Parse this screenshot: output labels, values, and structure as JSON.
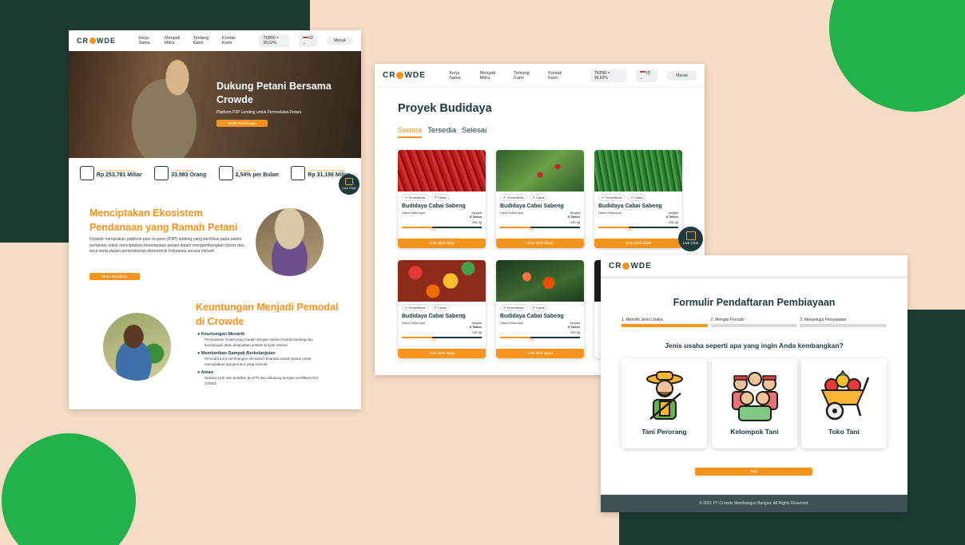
{
  "colors": {
    "accent": "#f7941d",
    "dark": "#1d3b3a",
    "green": "#22b24c",
    "peach": "#f6dcc4"
  },
  "nav": {
    "logo": "CR●WDE",
    "links": [
      "Kerja Sama",
      "Menjadi Mitra",
      "Tentang Kami",
      "Kontak Kami"
    ],
    "tkb": "TKB90 = 99,62%",
    "lang": "ID",
    "login": "Masuk"
  },
  "landing": {
    "hero_title": "Dukung Petani Bersama Crowde",
    "hero_sub": "Platform P2P Lending untuk Permodalan Petani",
    "hero_cta": "Mulai Pendanaan",
    "stats": [
      {
        "label": "Total Penyaluran Sejak Berdiri",
        "value": "Rp 253,781 Miliar"
      },
      {
        "label": "Jumlah Peminjam",
        "value": "33.983 Orang"
      },
      {
        "label": "Suku Bunga Flat",
        "value": "2,54% per Bulan"
      },
      {
        "label": "Total Penyaluran Outstanding",
        "value": "Rp 31,198 Miliar"
      }
    ],
    "live_chat": "Live Chat",
    "eco_title": "Menciptakan Ekosistem Pendanaan yang Ramah Petani",
    "eco_body": "Crowde merupakan platform peer-to-peer (P2P) lending yang berfokus pada sektor pertanian untuk menciptakan kesempatan petani dalam mengembangkan bisnis dan turut serta dalam pertumbuhan ekonomi di Indonesia secara inklusif.",
    "eco_cta": "Mulai Mendanai",
    "benefit_title": "Keuntungan Menjadi Pemodal di Crowde",
    "benefits": [
      {
        "title": "Keuntungan Menarik",
        "body": "Penanaman modal yang mudah dengan melalui mobile banking dan keuntungan akan didapatkan setelah proyek selesai"
      },
      {
        "title": "Memberikan Dampak Berkelanjutan",
        "body": "Pemodal turut membangun ekosistem finansial ramah petani untuk menciptakan agropreneur yang mandiri."
      },
      {
        "title": "Aman",
        "body": "Diawasi OJK dan terdaftar di AFPI dan didukung dengan sertifikasi ISO 270001."
      }
    ]
  },
  "projects": {
    "title": "Proyek Budidaya",
    "tabs": [
      "Semua",
      "Tersedia",
      "Selesai"
    ],
    "tag_verified": "Terverifikasi",
    "tag_crop": "Cabai",
    "card_title": "Budidaya Cabai Sabeng",
    "collected": "Dana Terkumpul",
    "tenor_label": "Jangka",
    "tenor": "8 Tahun",
    "amount": "255,3jt",
    "progress_label": "125jt",
    "progress": 0.38,
    "cta": "Lihat lebih lanjut",
    "live_chat": "Live Chat"
  },
  "form": {
    "logo": "CR●WDE",
    "title": "Formulir Pendaftaran Pembiayaan",
    "steps": [
      "1. Memilih Jenis Usaha",
      "2. Mengisi Formulir",
      "3. Menyetujui Persyaratan"
    ],
    "question": "Jenis usaha seperti apa yang ingin Anda kembangkan?",
    "options": [
      "Tani Perorang",
      "Kelompok Tani",
      "Toko Tani"
    ],
    "next": "Maju",
    "footer": "© 2021 PT Crowde Membangun Bangsa. All Rights Reserved."
  }
}
